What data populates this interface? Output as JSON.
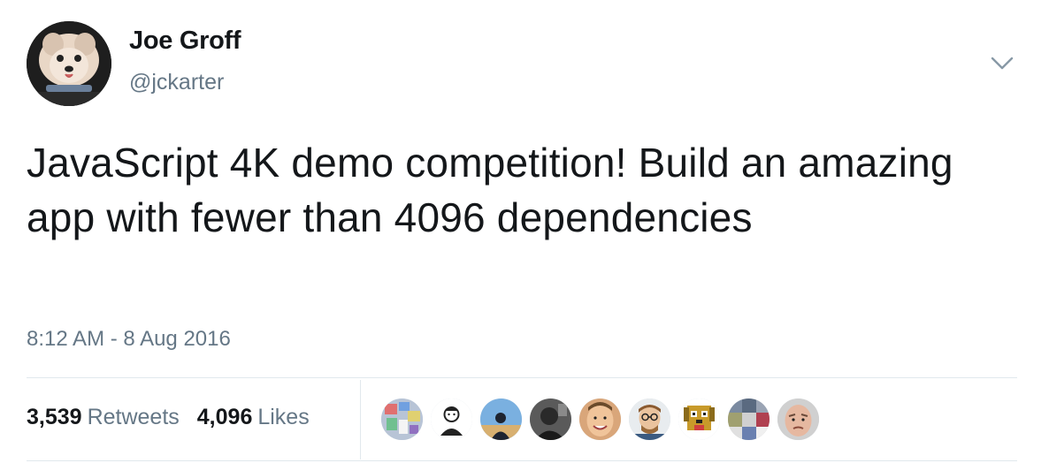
{
  "user": {
    "display_name": "Joe Groff",
    "handle": "@jckarter",
    "avatar_icon": "dog-avatar"
  },
  "header": {
    "menu_icon": "chevron-down-icon"
  },
  "tweet": {
    "text": "JavaScript 4K demo competition! Build an amazing app with fewer than 4096 dependencies",
    "timestamp": "8:12 AM - 8 Aug 2016"
  },
  "stats": {
    "retweets_count": "3,539",
    "retweets_label": "Retweets",
    "likes_count": "4,096",
    "likes_label": "Likes"
  },
  "likers": [
    {
      "icon": "collage-avatar"
    },
    {
      "icon": "person-illustration-avatar"
    },
    {
      "icon": "silhouette-sky-avatar"
    },
    {
      "icon": "dark-portrait-avatar"
    },
    {
      "icon": "smiling-face-avatar"
    },
    {
      "icon": "glasses-man-avatar"
    },
    {
      "icon": "pixel-dog-avatar"
    },
    {
      "icon": "pixel-blocks-avatar"
    },
    {
      "icon": "bald-man-avatar"
    }
  ],
  "colors": {
    "text_primary": "#14171a",
    "text_secondary": "#657786",
    "divider": "#e1e8ed"
  }
}
